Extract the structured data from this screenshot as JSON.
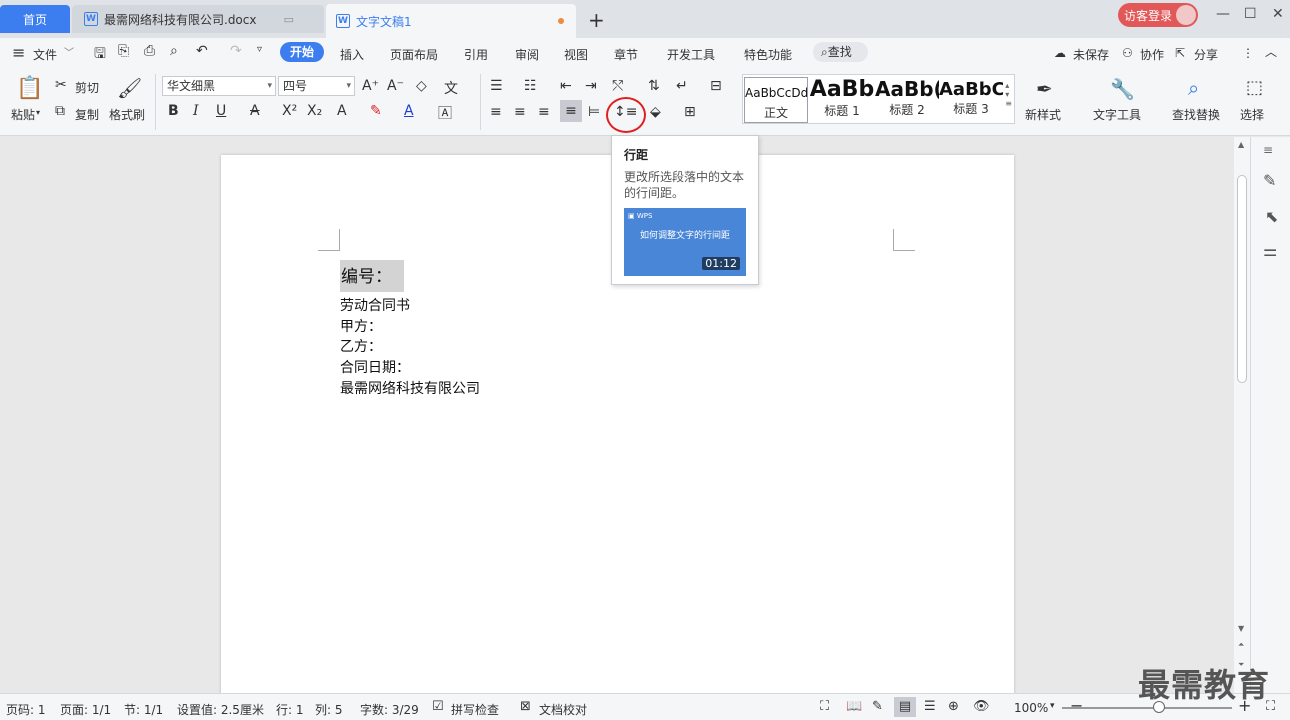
{
  "tabs": {
    "home": "首页",
    "doc1": "最需网络科技有限公司.docx",
    "doc2": "文字文稿1",
    "new_tab": "+"
  },
  "window": {
    "login": "访客登录",
    "minimize": "—",
    "maximize": "☐",
    "close": "✕"
  },
  "menu": {
    "hamburger": "≡",
    "file": "文件",
    "items": [
      "开始",
      "插入",
      "页面布局",
      "引用",
      "审阅",
      "视图",
      "章节",
      "开发工具",
      "特色功能"
    ],
    "search": "查找",
    "unsaved": "未保存",
    "collab": "协作",
    "share": "分享"
  },
  "ribbon": {
    "paste": "粘贴",
    "cut": "剪切",
    "copy": "复制",
    "format_painter": "格式刷",
    "font_name": "华文细黑",
    "font_size": "四号",
    "styles": [
      {
        "preview": "AaBbCcDd",
        "label": "正文"
      },
      {
        "preview": "AaBb",
        "label": "标题 1"
      },
      {
        "preview": "AaBb(",
        "label": "标题 2"
      },
      {
        "preview": "AaBbC",
        "label": "标题 3"
      }
    ],
    "new_style": "新样式",
    "text_tools": "文字工具",
    "find_replace": "查找替换",
    "select": "选择"
  },
  "tooltip": {
    "title": "行距",
    "description": "更改所选段落中的文本的行间距。",
    "video_title": "如何调整文字的行间距",
    "video_duration": "01:12"
  },
  "document": {
    "lines": [
      "编号：",
      "劳动合同书",
      "甲方：",
      "乙方：",
      "合同日期：",
      "最需网络科技有限公司"
    ]
  },
  "status": {
    "page_num": "页码: 1",
    "pages": "页面: 1/1",
    "section": "节: 1/1",
    "setting": "设置值: 2.5厘米",
    "row": "行: 1",
    "col": "列: 5",
    "words": "字数: 3/29",
    "spell_check": "拼写检查",
    "doc_check": "文档校对",
    "zoom": "100%"
  },
  "watermark": "最需教育",
  "colors": {
    "accent": "#3c7ef0",
    "login_bg": "#e25858",
    "highlight_ring": "#e02020"
  }
}
